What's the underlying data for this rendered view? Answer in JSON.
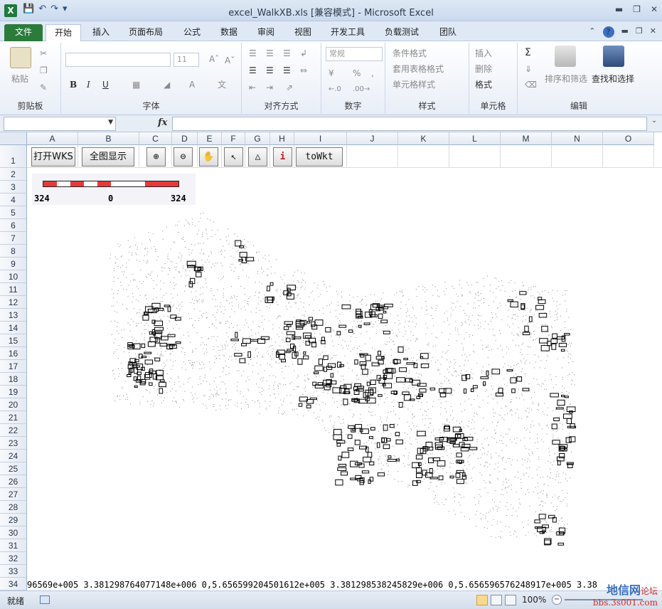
{
  "window": {
    "title": "excel_WalkXB.xls [兼容模式] - Microsoft Excel",
    "app_icon": "X"
  },
  "ribbon_tabs": [
    "文件",
    "开始",
    "插入",
    "页面布局",
    "公式",
    "数据",
    "审阅",
    "视图",
    "开发工具",
    "负载测试",
    "团队"
  ],
  "ribbon_groups": {
    "clipboard": {
      "paste": "粘贴",
      "label": "剪贴板"
    },
    "font": {
      "size": "11",
      "label": "字体",
      "bold": "B",
      "italic": "I",
      "underline": "U"
    },
    "alignment": {
      "label": "对齐方式"
    },
    "number": {
      "format": "常规",
      "label": "数字",
      "percent": "%",
      "comma": ","
    },
    "styles": {
      "cond_format": "条件格式",
      "table_format": "套用表格格式",
      "cell_styles": "单元格样式",
      "label": "样式"
    },
    "cells": {
      "insert": "插入",
      "delete": "删除",
      "format": "格式",
      "label": "单元格"
    },
    "editing": {
      "sum": "Σ",
      "sort": "排序和筛选",
      "find": "查找和选择",
      "label": "编辑"
    }
  },
  "formula_bar": {
    "fx": "fx"
  },
  "columns": [
    "A",
    "B",
    "C",
    "D",
    "E",
    "F",
    "G",
    "H",
    "I",
    "J",
    "K",
    "L",
    "M",
    "N",
    "O"
  ],
  "rows": [
    "1",
    "2",
    "3",
    "4",
    "5",
    "6",
    "7",
    "8",
    "9",
    "10",
    "11",
    "12",
    "13",
    "14",
    "15",
    "16",
    "17",
    "18",
    "19",
    "20",
    "21",
    "22",
    "23",
    "24",
    "25",
    "26",
    "27",
    "28",
    "29",
    "30",
    "31",
    "32",
    "33",
    "34"
  ],
  "toolbar_buttons": {
    "open_wks": "打开WKS",
    "full_extent": "全图显示",
    "towkt": "toWkt"
  },
  "scale_bar": {
    "left": "324",
    "mid": "0",
    "right": "324"
  },
  "row34_text": "96569e+005 3.381298764077148e+006 0,5.656599204501612e+005 3.381298538245829e+006 0,5.656596576248917e+005 3.38",
  "status": {
    "ready": "就绪",
    "zoom": "100%"
  },
  "watermark": {
    "line1": "地信网",
    "line1_tag": "论坛",
    "line2": "bbs.3s001.com"
  }
}
